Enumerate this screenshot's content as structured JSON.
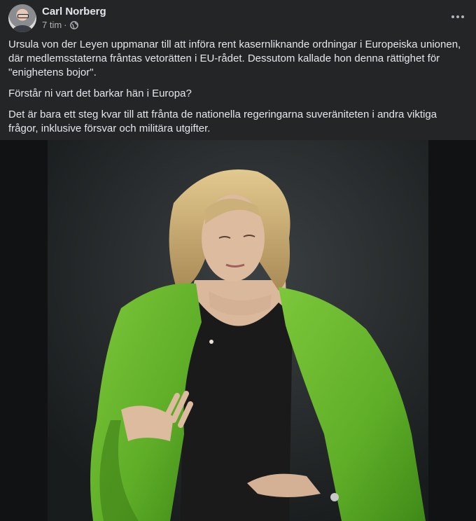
{
  "post": {
    "author": "Carl Norberg",
    "time": "7 tim",
    "separator": "·",
    "privacy_icon": "globe-icon",
    "more_icon": "more-options-icon",
    "paragraphs": [
      "Ursula von der Leyen uppmanar till att införa rent kasernliknande ordningar i Europeiska unionen, där medlemsstaterna fråntas vetorätten i EU-rådet. Dessutom kallade hon denna rättighet för \"enighetens bojor\".",
      "Förstår ni vart det barkar hän i Europa?",
      "Det är bara ett steg kvar till att frånta de nationella regeringarna suveräniteten i andra viktiga frågor, inklusive försvar och militära utgifter."
    ]
  },
  "colors": {
    "background": "#242526",
    "primary_text": "#e4e6eb",
    "secondary_text": "#b0b3b8",
    "jacket_green": "#6ab82e"
  }
}
